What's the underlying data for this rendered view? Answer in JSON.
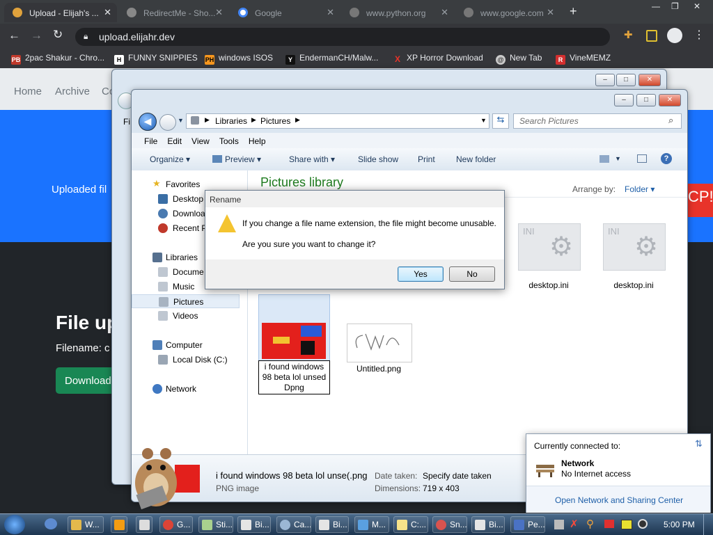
{
  "browser": {
    "tabs": [
      {
        "title": "Upload - Elijah's ..."
      },
      {
        "title": "RedirectMe - Sho..."
      },
      {
        "title": "Google"
      },
      {
        "title": "www.python.org"
      },
      {
        "title": "www.google.com"
      }
    ],
    "new_tab_symbol": "+",
    "url": "upload.elijahr.dev",
    "bookmarks": [
      {
        "label": "2pac Shakur - Chro...",
        "icon": "PB"
      },
      {
        "label": "FUNNY SNIPPIES",
        "icon": "H"
      },
      {
        "label": "windows ISOS",
        "icon": "PH"
      },
      {
        "label": "EndermanCH/Malw...",
        "icon": "Y"
      },
      {
        "label": "XP Horror Download",
        "icon": "X"
      },
      {
        "label": "New Tab",
        "icon": "@"
      },
      {
        "label": "VineMEMZ",
        "icon": "R"
      }
    ]
  },
  "page": {
    "nav_home": "Home",
    "nav_archive": "Archive",
    "nav_partial": "Co",
    "uploaded_partial": "Uploaded fil",
    "cp_partial": "CP!",
    "file_heading_partial": "File up",
    "filename_partial": "Filename: c",
    "download_partial": "Download"
  },
  "explorer": {
    "breadcrumb": [
      "Libraries",
      "Pictures"
    ],
    "search_placeholder": "Search Pictures",
    "menu": [
      "File",
      "Edit",
      "View",
      "Tools",
      "Help"
    ],
    "commands": [
      "Organize",
      "Preview",
      "Share with",
      "Slide show",
      "Print",
      "New folder"
    ],
    "nav": {
      "favorites": "Favorites",
      "desktop": "Desktop",
      "downloads": "Downloa",
      "recent": "Recent P",
      "libraries": "Libraries",
      "documents": "Docume",
      "music": "Music",
      "pictures": "Pictures",
      "videos": "Videos",
      "computer": "Computer",
      "local_disk": "Local Disk (C:)",
      "network": "Network"
    },
    "library_title": "Pictures library",
    "arrange_label": "Arrange by:",
    "arrange_value": "Folder",
    "files": [
      {
        "name": "desktop.ini"
      },
      {
        "name": "desktop.ini"
      },
      {
        "name": "i found windows 98 beta lol unsed Dpng"
      },
      {
        "name": "Untitled.png"
      }
    ],
    "details": {
      "filename": "i found windows 98 beta lol unse(.png",
      "type": "PNG image",
      "date_label": "Date taken:",
      "date_value": "Specify date taken",
      "dim_label": "Dimensions:",
      "dim_value": "719 x 403"
    }
  },
  "dialog": {
    "title": "Rename",
    "line1": "If you change a file name extension, the file might become unusable.",
    "line2": "Are you sure you want to change it?",
    "yes": "Yes",
    "no": "No"
  },
  "network_popup": {
    "header": "Currently connected to:",
    "network_name": "Network",
    "status": "No Internet access",
    "link": "Open Network and Sharing Center"
  },
  "taskbar": {
    "items": [
      "W...",
      "",
      "",
      "G...",
      "Sti...",
      "Bi...",
      "Ca...",
      "Bi...",
      "M...",
      "C:...",
      "Sn...",
      "Bi...",
      "Pe..."
    ],
    "clock": "5:00 PM"
  },
  "colors": {
    "chrome_dark": "#35363a",
    "hero_blue": "#1a73ff",
    "library_green": "#1e7b1e",
    "download_green": "#198754",
    "cp_red": "#e8332a"
  }
}
